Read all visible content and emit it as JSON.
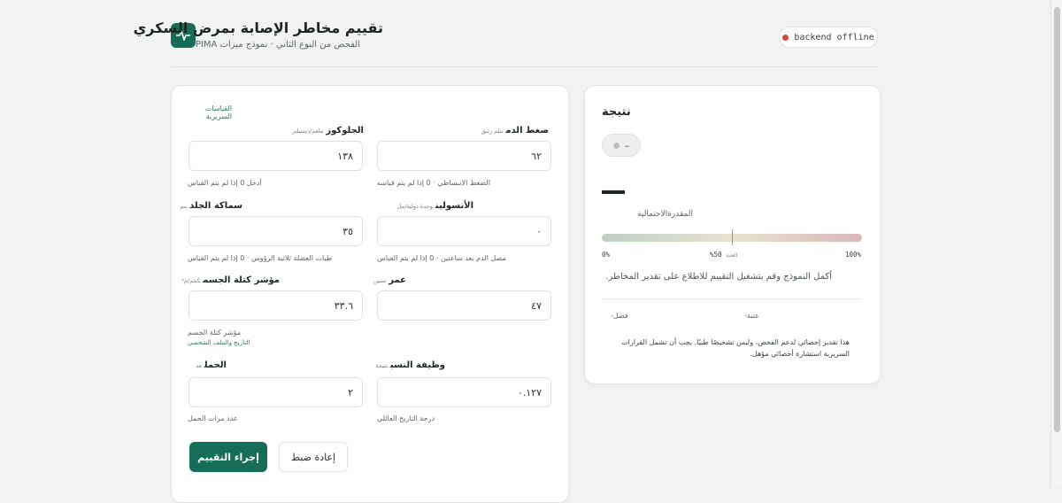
{
  "header": {
    "title": "تقييم مخاطر الإصابة بمرض السكري",
    "subtitle": "الفحص من النوع الثاني · نموذج ميزات PIMA",
    "status": "backend offline",
    "logo_icon": "heartbeat-icon"
  },
  "form": {
    "section_label": "القياسات السريرية",
    "fields": {
      "glucose": {
        "label": "الجلوكوز",
        "unit": "ملغم/ديسيلتر",
        "value": "١٣٨",
        "hint": "أدخل 0 إذا لم يتم القياس"
      },
      "blood_pressure": {
        "label": "ضغط الدم",
        "unit": "ملم زئبق",
        "value": "٦٢",
        "hint": "الضغط الانبساطي · 0 إذا لم يتم قياسه"
      },
      "skin": {
        "label": "سماكة الجلد",
        "unit": "مم",
        "value": "٣٥",
        "hint": "طيات العضلة ثلاثية الرؤوس · 0 إذا لم يتم القياس"
      },
      "insulin": {
        "label": "الأنسولين",
        "unit": "وحدة دولية/مل",
        "value": "٠",
        "hint": "مصل الدم بعد ساعتين · 0 إذا لم يتم القياس"
      },
      "bmi": {
        "label": "مؤشر كتلة الجسم",
        "unit": "كجم/م²",
        "value": "٣٣.٦",
        "hint": "مؤشر كتلة الجسم"
      },
      "age": {
        "label": "عمر",
        "unit": "سنين",
        "value": "٤٧",
        "hint": ""
      },
      "pregnancies": {
        "label": "الحمل",
        "unit": "عد",
        "value": "٢",
        "hint": "عدد مرات الحمل"
      },
      "pedigree": {
        "label": "وظيفة النسب",
        "unit": "نتيجة",
        "value": "٠.١٢٧",
        "hint": "درجة التاريخ العائلي"
      }
    },
    "history_section_label": "التاريخ والملف الشخصي",
    "submit_label": "إجراء التقييم",
    "reset_label": "إعادة ضبط"
  },
  "result": {
    "title": "نتيجة",
    "chip_value": "–",
    "risk_label": "المقدرةالاحتمالية",
    "scale_min": "0%",
    "scale_mid": "%50",
    "scale_mid_label": "العتبة",
    "scale_max": "100%",
    "message": "أكمل النموذج وقم بتشغيل التقييم للاطلاع على تقدير المخاطر.",
    "meta_left": "فصل-",
    "meta_right": "عتبة-",
    "disclaimer": "هذا تقدير إحصائي لدعم الفحص، وليس تشخيصًا طبيًا. يجب أن تشمل القرارات السريرية استشارة أخصائي مؤهل."
  },
  "colors": {
    "brand": "#176e58",
    "status_dot": "#d84b3a"
  }
}
